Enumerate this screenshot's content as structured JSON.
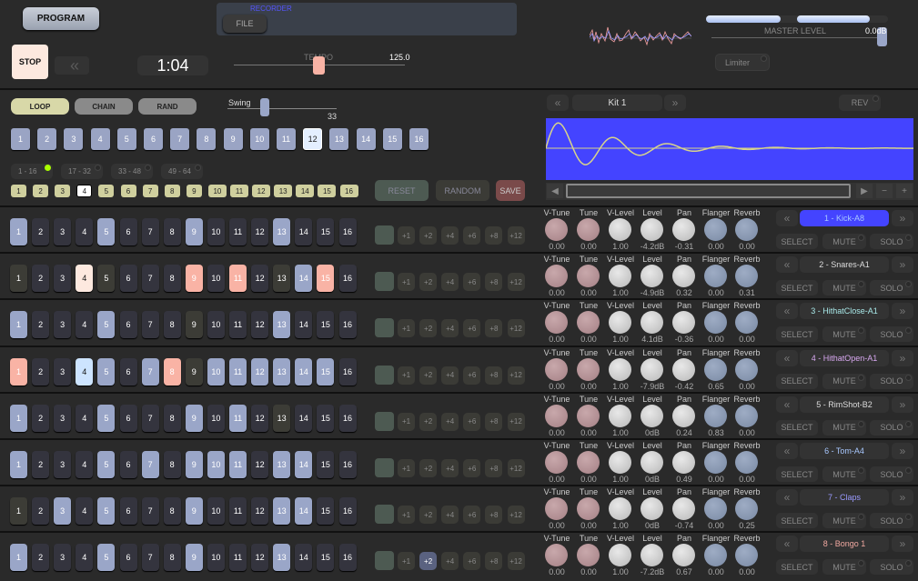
{
  "transport": {
    "program_label": "PROGRAM",
    "stop_label": "STOP",
    "rewind_icon": "«",
    "time": "1:04",
    "recorder_label": "RECORDER",
    "file_label": "FILE",
    "tempo_label": "TEMPO",
    "tempo_value": "125.0",
    "master_label": "MASTER LEVEL",
    "master_value": "0.0dB",
    "limiter_label": "Limiter"
  },
  "modes": {
    "loop": "LOOP",
    "chain": "CHAIN",
    "rand": "RAND"
  },
  "swing": {
    "label": "Swing",
    "value": "33"
  },
  "patterns": {
    "items": [
      "1",
      "2",
      "3",
      "4",
      "5",
      "6",
      "7",
      "8",
      "9",
      "10",
      "11",
      "12",
      "13",
      "14",
      "15",
      "16"
    ],
    "selected": 12
  },
  "banks": [
    {
      "label": "1 - 16",
      "active": true
    },
    {
      "label": "17 - 32",
      "active": false
    },
    {
      "label": "33 - 48",
      "active": false
    },
    {
      "label": "49 - 64",
      "active": false
    }
  ],
  "pages": {
    "items": [
      "1",
      "2",
      "3",
      "4",
      "5",
      "6",
      "7",
      "8",
      "9",
      "10",
      "11",
      "12",
      "13",
      "14",
      "15",
      "16"
    ],
    "selected": 4
  },
  "actions": {
    "reset": "RESET",
    "random": "RANDOM",
    "save": "SAVE"
  },
  "kit": {
    "prev": "«",
    "name": "Kit 1",
    "next": "»",
    "rev_label": "REV"
  },
  "waveform": {
    "bg_color": "#4444ff",
    "line_color": "#d8d48a"
  },
  "scroll": {
    "left": "◀",
    "right": "▶",
    "minus": "−",
    "plus": "+"
  },
  "knob_labels": [
    "V-Tune",
    "Tune",
    "V-Level",
    "Level",
    "Pan",
    "Flanger",
    "Reverb"
  ],
  "offset_labels": [
    "+1",
    "+2",
    "+4",
    "+6",
    "+8",
    "+12"
  ],
  "channel_buttons": {
    "select": "SELECT",
    "mute": "MUTE",
    "solo": "SOLO"
  },
  "tracks": [
    {
      "name": "1 - Kick-A8",
      "name_color": "#a8c8ff",
      "name_bg": "#4444ff",
      "steps": [
        "on",
        "",
        "",
        "",
        "on",
        "",
        "",
        "",
        "on",
        "",
        "",
        "",
        "on",
        "",
        "",
        ""
      ],
      "values": [
        "0.00",
        "0.00",
        "1.00",
        "-4.2dB",
        "-0.31",
        "0.00",
        "0.00"
      ],
      "offset_on": -1
    },
    {
      "name": "2 - Snares-A1",
      "name_color": "#dddddd",
      "name_bg": "#333333",
      "steps": [
        "dim",
        "",
        "",
        "cur",
        "dim",
        "",
        "",
        "",
        "acc",
        "",
        "acc",
        "",
        "dim",
        "on",
        "acc",
        ""
      ],
      "values": [
        "0.00",
        "0.00",
        "1.00",
        "-4.9dB",
        "0.32",
        "0.00",
        "0.31"
      ],
      "offset_on": -1
    },
    {
      "name": "3 - HithatClose-A1",
      "name_color": "#a8e8e8",
      "name_bg": "#333333",
      "steps": [
        "on",
        "",
        "",
        "",
        "on",
        "",
        "",
        "",
        "dim",
        "",
        "",
        "",
        "on",
        "",
        "",
        ""
      ],
      "values": [
        "0.00",
        "0.00",
        "1.00",
        "4.1dB",
        "-0.36",
        "0.00",
        "0.00"
      ],
      "offset_on": -1
    },
    {
      "name": "4 - HithatOpen-A1",
      "name_color": "#d8a8f0",
      "name_bg": "#333333",
      "steps": [
        "acc",
        "",
        "",
        "hi",
        "on",
        "",
        "on",
        "acc",
        "dim",
        "on",
        "on",
        "on",
        "on",
        "on",
        "on",
        ""
      ],
      "values": [
        "0.00",
        "0.00",
        "1.00",
        "-7.9dB",
        "-0.42",
        "0.65",
        "0.00"
      ],
      "offset_on": -1
    },
    {
      "name": "5 - RimShot-B2",
      "name_color": "#dddddd",
      "name_bg": "#333333",
      "steps": [
        "on",
        "",
        "",
        "",
        "on",
        "",
        "",
        "",
        "on",
        "",
        "on",
        "",
        "dim",
        "",
        "",
        ""
      ],
      "values": [
        "0.00",
        "0.00",
        "1.00",
        "0dB",
        "0.24",
        "0.83",
        "0.00"
      ],
      "offset_on": -1
    },
    {
      "name": "6 - Tom-A4",
      "name_color": "#a8c8ff",
      "name_bg": "#333333",
      "steps": [
        "on",
        "",
        "",
        "",
        "on",
        "",
        "on",
        "",
        "on",
        "on",
        "on",
        "",
        "on",
        "on",
        "",
        ""
      ],
      "values": [
        "0.00",
        "0.00",
        "1.00",
        "0dB",
        "0.49",
        "0.00",
        "0.00"
      ],
      "offset_on": -1
    },
    {
      "name": "7 - Claps",
      "name_color": "#9a9aff",
      "name_bg": "#333333",
      "steps": [
        "dim",
        "",
        "on",
        "",
        "on",
        "",
        "",
        "",
        "on",
        "",
        "",
        "",
        "on",
        "on",
        "",
        ""
      ],
      "values": [
        "0.00",
        "0.00",
        "1.00",
        "0dB",
        "-0.74",
        "0.00",
        "0.25"
      ],
      "offset_on": -1
    },
    {
      "name": "8 - Bongo 1",
      "name_color": "#f0a8a0",
      "name_bg": "#333333",
      "steps": [
        "on",
        "",
        "",
        "",
        "on",
        "",
        "",
        "",
        "on",
        "",
        "",
        "",
        "on",
        "",
        "",
        ""
      ],
      "values": [
        "0.00",
        "0.00",
        "1.00",
        "-7.2dB",
        "0.67",
        "0.00",
        "0.00"
      ],
      "offset_on": 1
    }
  ]
}
